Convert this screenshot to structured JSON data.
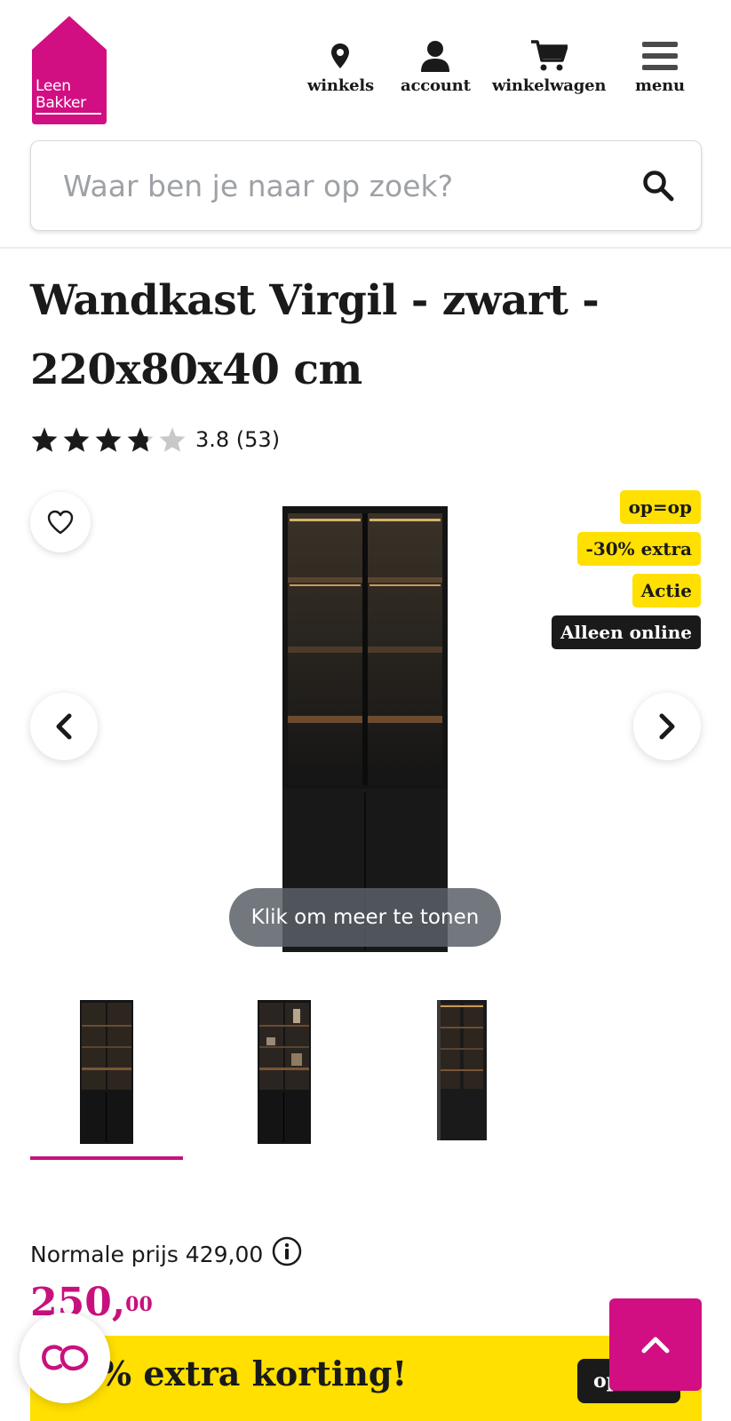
{
  "brand": {
    "name_line1": "Leen",
    "name_line2": "Bakker",
    "color": "#d10f82"
  },
  "nav": {
    "stores_label": "winkels",
    "account_label": "account",
    "cart_label": "winkelwagen",
    "menu_label": "menu"
  },
  "search": {
    "placeholder": "Waar ben je naar op zoek?"
  },
  "product": {
    "title": "Wandkast Virgil - zwart - 220x80x40 cm",
    "rating_value": 3.8,
    "rating_text": "3.8 (53)",
    "badges": [
      {
        "label": "op=op",
        "style": "yellow"
      },
      {
        "label": "-30% extra",
        "style": "yellow"
      },
      {
        "label": "Actie",
        "style": "yellow"
      },
      {
        "label": "Alleen online",
        "style": "dark"
      }
    ],
    "show_more_label": "Klik om meer te tonen",
    "thumbnails_count": 3,
    "active_thumbnail": 0
  },
  "price": {
    "normal_label": "Normale prijs 429,00",
    "current_main": "250,",
    "current_cents": "00",
    "color": "#c8117d"
  },
  "promo": {
    "text": "% extra korting!",
    "button_label": "op",
    "background": "#ffe000"
  },
  "icons": {
    "stores": "map-pin-icon",
    "account": "user-icon",
    "cart": "cart-icon",
    "menu": "hamburger-icon",
    "search": "search-icon",
    "favorite": "heart-icon",
    "prev": "chevron-left-icon",
    "next": "chevron-right-icon",
    "info": "info-icon",
    "chat": "chat-icon",
    "back_to_top": "chevron-up-icon"
  }
}
